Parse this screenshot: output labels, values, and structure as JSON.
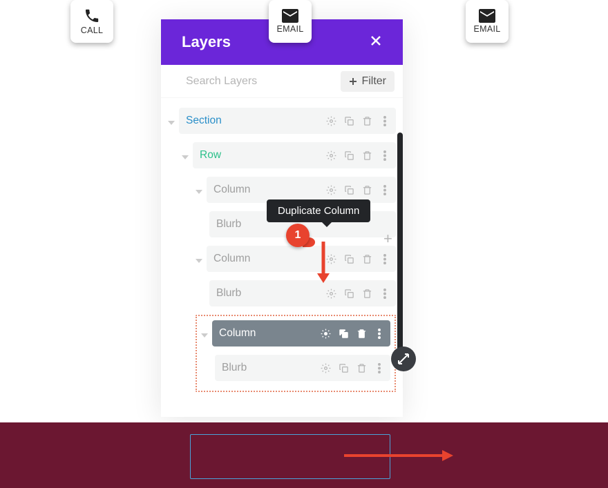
{
  "panel": {
    "title": "Layers",
    "search_placeholder": "Search Layers",
    "filter_label": "Filter"
  },
  "tree": {
    "section": {
      "label": "Section"
    },
    "row": {
      "label": "Row"
    },
    "col1": {
      "label": "Column",
      "blurb": "Blurb"
    },
    "col2": {
      "label": "Column",
      "blurb": "Blurb"
    },
    "col3": {
      "label": "Column",
      "blurb": "Blurb"
    }
  },
  "tooltip": "Duplicate Column",
  "marker": "1",
  "cta": {
    "call": "CALL",
    "email": "EMAIL"
  }
}
